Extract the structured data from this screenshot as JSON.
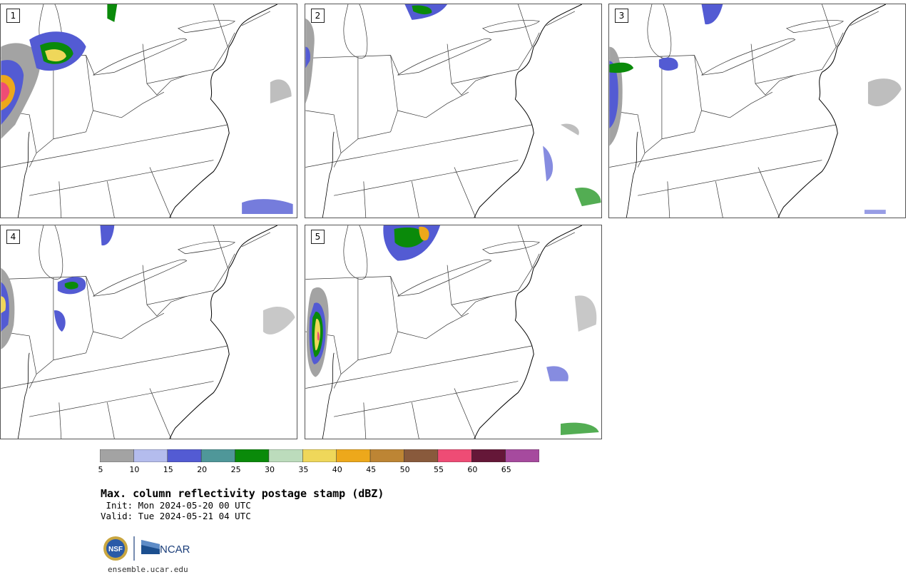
{
  "panels": [
    {
      "label": "1"
    },
    {
      "label": "2"
    },
    {
      "label": "3"
    },
    {
      "label": "4"
    },
    {
      "label": "5"
    }
  ],
  "colorbar": {
    "ticks": [
      "5",
      "10",
      "15",
      "20",
      "25",
      "30",
      "35",
      "40",
      "45",
      "50",
      "55",
      "60",
      "65"
    ],
    "colors": [
      "#a3a3a3",
      "#b4bced",
      "#535bd3",
      "#4f9799",
      "#0a8a0a",
      "#bcdcbc",
      "#efd75a",
      "#eda81b",
      "#bd8534",
      "#895a3c",
      "#ee4c75",
      "#651738",
      "#a64a9e"
    ]
  },
  "title": "Max. column reflectivity postage stamp (dBZ)",
  "init": " Init: Mon 2024-05-20 00 UTC",
  "valid": "Valid: Tue 2024-05-21 04 UTC",
  "logos": {
    "nsf": "NSF",
    "ncar": "NCAR"
  },
  "site": "ensemble.ucar.edu"
}
